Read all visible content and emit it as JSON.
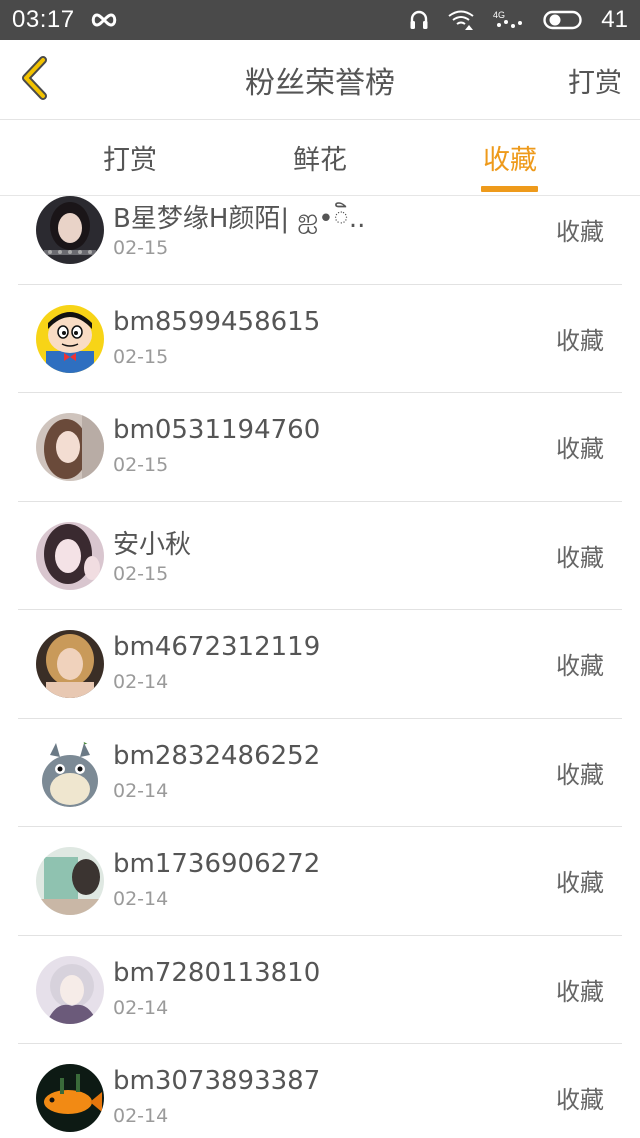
{
  "status_bar": {
    "time": "03:17",
    "battery_percent": "41",
    "icons": [
      "infinity-icon",
      "headphones-icon",
      "wifi-icon",
      "signal-4g-icon",
      "battery-toggle-icon"
    ]
  },
  "header": {
    "title": "粉丝荣誉榜",
    "action_label": "打赏",
    "back_icon": "chevron-left-icon",
    "accent_color": "#ee9a1b"
  },
  "tabs": [
    {
      "label": "打赏",
      "active": false
    },
    {
      "label": "鲜花",
      "active": false
    },
    {
      "label": "收藏",
      "active": true
    }
  ],
  "fans": [
    {
      "name": "B星梦缘H颜陌| ஐ•ិ..",
      "date": "02-15",
      "type": "收藏",
      "avatar": "girl-dark-hair-avatar"
    },
    {
      "name": "bm8599458615",
      "date": "02-15",
      "type": "收藏",
      "avatar": "cartoon-boy-avatar"
    },
    {
      "name": "bm0531194760",
      "date": "02-15",
      "type": "收藏",
      "avatar": "girl-long-hair-avatar"
    },
    {
      "name": "安小秋",
      "date": "02-15",
      "type": "收藏",
      "avatar": "girl-selfie-avatar"
    },
    {
      "name": "bm4672312119",
      "date": "02-14",
      "type": "收藏",
      "avatar": "girl-blonde-avatar"
    },
    {
      "name": "bm2832486252",
      "date": "02-14",
      "type": "收藏",
      "avatar": "totoro-avatar"
    },
    {
      "name": "bm1736906272",
      "date": "02-14",
      "type": "收藏",
      "avatar": "book-reader-avatar"
    },
    {
      "name": "bm7280113810",
      "date": "02-14",
      "type": "收藏",
      "avatar": "anime-character-avatar"
    },
    {
      "name": "bm3073893387",
      "date": "02-14",
      "type": "收藏",
      "avatar": "goldfish-avatar"
    }
  ]
}
